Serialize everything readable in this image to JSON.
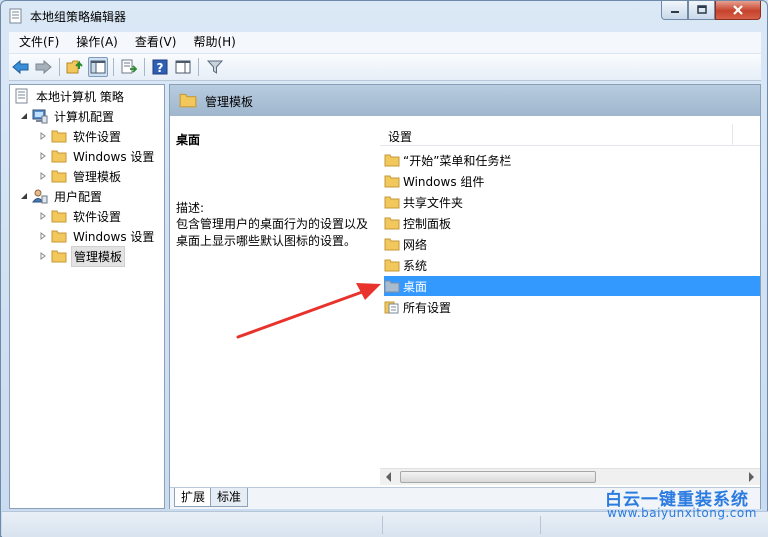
{
  "window": {
    "title": "本地组策略编辑器"
  },
  "menu": [
    {
      "label": "文件(F)"
    },
    {
      "label": "操作(A)"
    },
    {
      "label": "查看(V)"
    },
    {
      "label": "帮助(H)"
    }
  ],
  "tree": {
    "root": "本地计算机 策略",
    "computer_config": {
      "label": "计算机配置",
      "children": [
        "软件设置",
        "Windows 设置",
        "管理模板"
      ]
    },
    "user_config": {
      "label": "用户配置",
      "children": [
        "软件设置",
        "Windows 设置",
        "管理模板"
      ]
    }
  },
  "main": {
    "header_title": "管理模板",
    "description": {
      "title": "桌面",
      "label": "描述:",
      "text": "包含管理用户的桌面行为的设置以及桌面上显示哪些默认图标的设置。"
    },
    "list": {
      "column_header": "设置",
      "items": [
        {
          "label": "“开始”菜单和任务栏"
        },
        {
          "label": "Windows 组件"
        },
        {
          "label": "共享文件夹"
        },
        {
          "label": "控制面板"
        },
        {
          "label": "网络"
        },
        {
          "label": "系统"
        },
        {
          "label": "桌面"
        },
        {
          "label": "所有设置"
        }
      ],
      "selected_index": 6
    },
    "tabs": [
      {
        "label": "扩展"
      },
      {
        "label": "标准"
      }
    ]
  },
  "watermark": {
    "title": "白云一键重装系统",
    "url": "www.baiyunxitong.com"
  },
  "colors": {
    "selection": "#3399ff",
    "header_band": "#a9bfd5",
    "folder": "#f2c75c",
    "arrow": "#e8322b",
    "watermark": "#2b7be0"
  }
}
